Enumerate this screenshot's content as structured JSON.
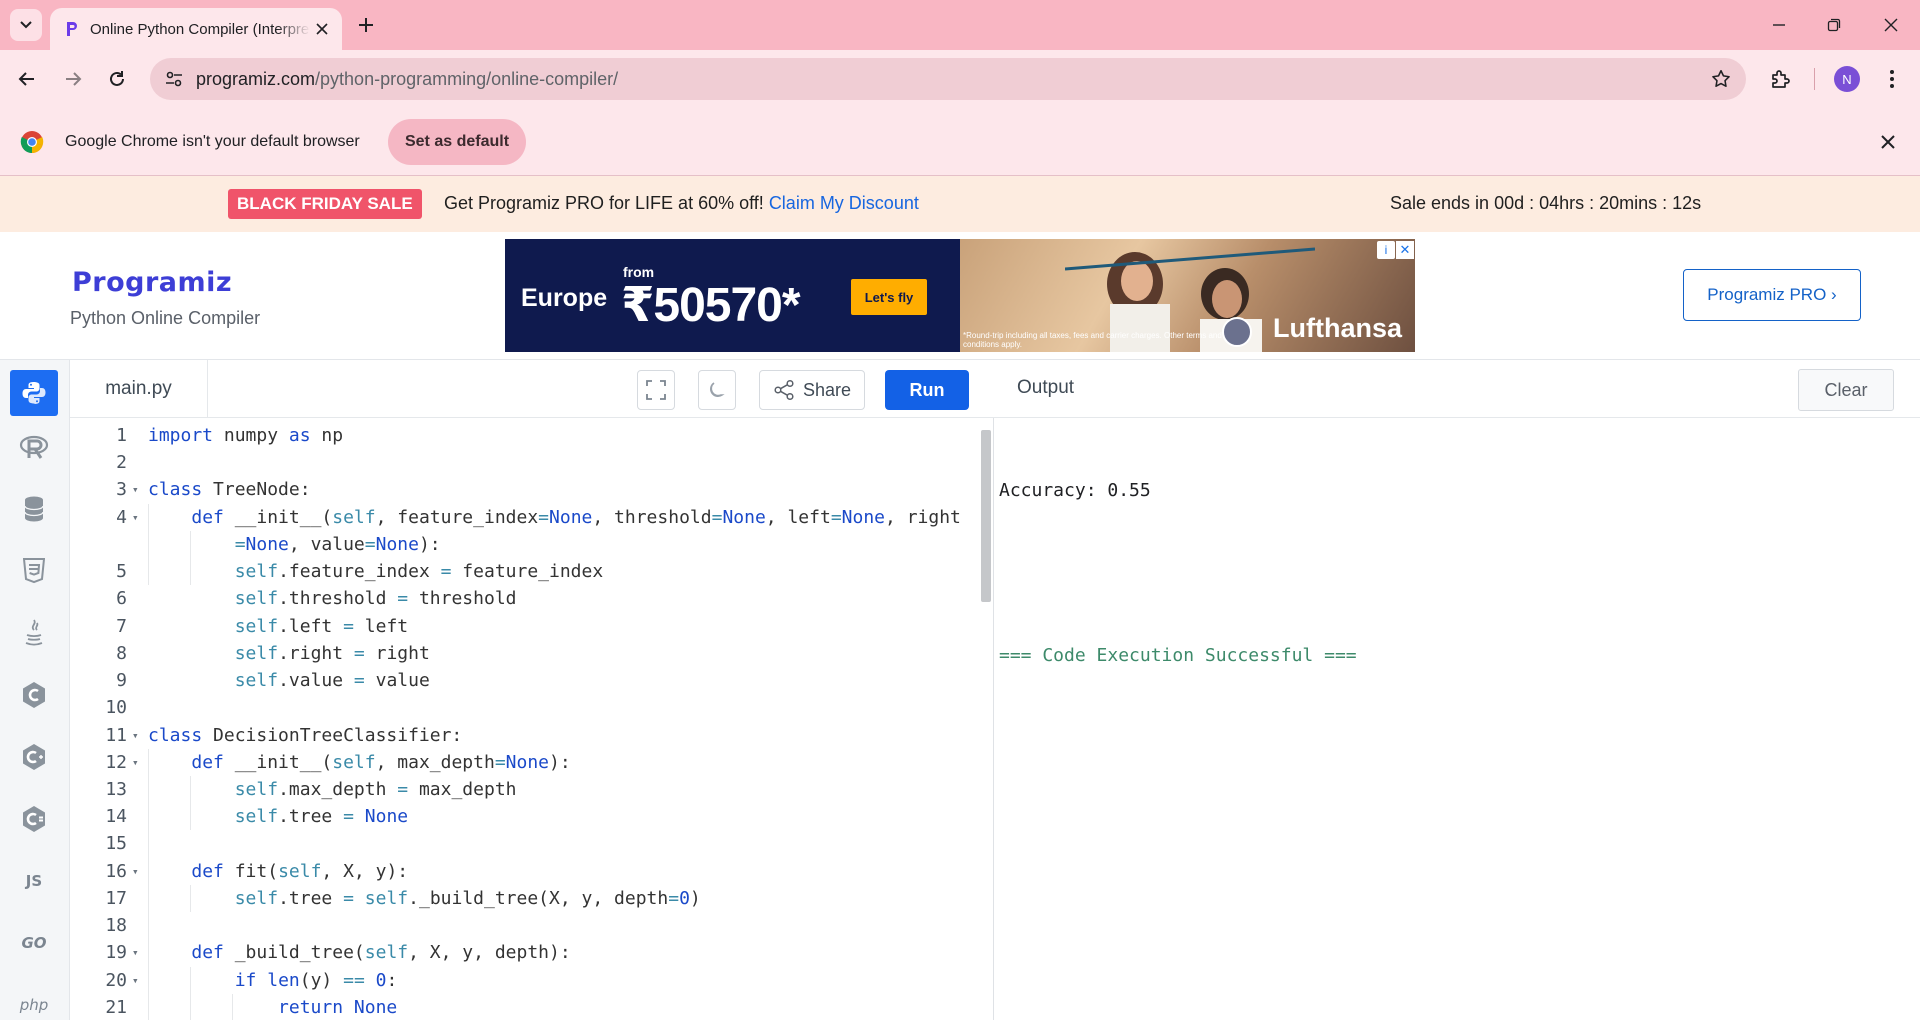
{
  "browser": {
    "tab_title": "Online Python Compiler (Interpreter)",
    "url_host": "programiz.com",
    "url_path": "/python-programming/online-compiler/",
    "avatar_letter": "N"
  },
  "infobar": {
    "message": "Google Chrome isn't your default browser",
    "button": "Set as default"
  },
  "promo": {
    "tag": "BLACK FRIDAY SALE",
    "text": "Get Programiz PRO for LIFE at 60% off!",
    "link": "Claim My Discount",
    "timer": "Sale ends in 00d : 04hrs : 20mins : 12s"
  },
  "header": {
    "logo": "Programiz",
    "subtitle": "Python Online Compiler",
    "pro_button": "Programiz PRO ›"
  },
  "ad": {
    "region": "Europe",
    "from": "from",
    "price": "₹50570*",
    "cta": "Let's fly",
    "fine_print": "*Round-trip including all taxes, fees and carrier charges. Other terms and conditions apply.",
    "brand": "Lufthansa"
  },
  "rail": {
    "items": [
      "python",
      "r",
      "sql",
      "html",
      "java",
      "c",
      "cpp",
      "csharp",
      "js",
      "go",
      "php"
    ],
    "js_label": "JS",
    "go_label": "GO",
    "php_label": "php"
  },
  "editor": {
    "file": "main.py",
    "share": "Share",
    "run": "Run"
  },
  "code": {
    "line_numbers": [
      "1",
      "2",
      "3",
      "4",
      "",
      "5",
      "6",
      "7",
      "8",
      "9",
      "10",
      "11",
      "12",
      "13",
      "14",
      "15",
      "16",
      "17",
      "18",
      "19",
      "20",
      "21"
    ]
  },
  "output": {
    "title": "Output",
    "clear": "Clear",
    "lines": [
      "Accuracy: 0.55",
      "",
      "=== Code Execution Successful ==="
    ]
  },
  "colors": {
    "accent": "#1361e6",
    "tabstrip": "#f9b6c3",
    "promo_tag": "#f0546a"
  }
}
